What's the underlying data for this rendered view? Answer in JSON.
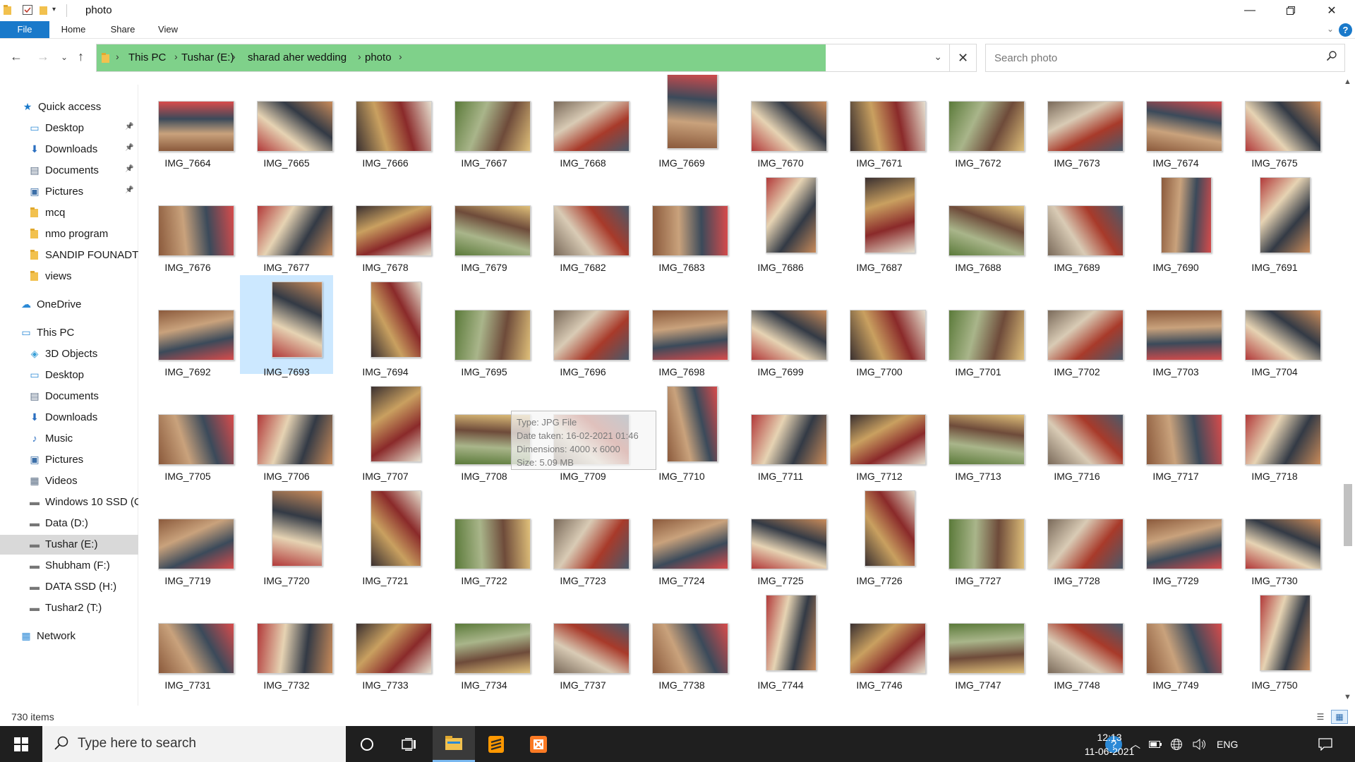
{
  "window": {
    "title": "photo",
    "tabs": [
      "File",
      "Home",
      "Share",
      "View"
    ],
    "help": "?"
  },
  "breadcrumb": [
    "This PC",
    "Tushar (E:)",
    "sharad aher wedding",
    "photo"
  ],
  "search": {
    "placeholder": "Search photo"
  },
  "nav": {
    "quick_access": "Quick access",
    "items": [
      {
        "label": "Quick access",
        "icon": "star-icon"
      },
      {
        "label": "Desktop",
        "icon": "desktop-icon",
        "pinned": true
      },
      {
        "label": "Downloads",
        "icon": "download-icon",
        "pinned": true
      },
      {
        "label": "Documents",
        "icon": "documents-icon",
        "pinned": true
      },
      {
        "label": "Pictures",
        "icon": "pictures-icon",
        "pinned": true
      },
      {
        "label": "mcq",
        "icon": "folder-icon"
      },
      {
        "label": "nmo program",
        "icon": "folder-icon"
      },
      {
        "label": "SANDIP FOUNADTI(",
        "icon": "folder-icon"
      },
      {
        "label": "views",
        "icon": "folder-icon"
      },
      {
        "label": "OneDrive",
        "icon": "cloud-icon"
      },
      {
        "label": "This PC",
        "icon": "computer-icon"
      },
      {
        "label": "3D Objects",
        "icon": "cube-icon"
      },
      {
        "label": "Desktop",
        "icon": "desktop-icon"
      },
      {
        "label": "Documents",
        "icon": "documents-icon"
      },
      {
        "label": "Downloads",
        "icon": "download-icon"
      },
      {
        "label": "Music",
        "icon": "music-icon"
      },
      {
        "label": "Pictures",
        "icon": "pictures-icon"
      },
      {
        "label": "Videos",
        "icon": "video-icon"
      },
      {
        "label": "Windows 10 SSD (C",
        "icon": "drive-icon"
      },
      {
        "label": "Data (D:)",
        "icon": "drive-icon"
      },
      {
        "label": "Tushar (E:)",
        "icon": "drive-icon"
      },
      {
        "label": "Shubham (F:)",
        "icon": "drive-icon"
      },
      {
        "label": "DATA SSD (H:)",
        "icon": "drive-icon"
      },
      {
        "label": "Tushar2 (T:)",
        "icon": "drive-icon"
      },
      {
        "label": "Network",
        "icon": "network-icon"
      }
    ]
  },
  "files": [
    {
      "name": "IMG_7664",
      "orient": "l"
    },
    {
      "name": "IMG_7665",
      "orient": "l"
    },
    {
      "name": "IMG_7666",
      "orient": "l"
    },
    {
      "name": "IMG_7667",
      "orient": "l"
    },
    {
      "name": "IMG_7668",
      "orient": "l"
    },
    {
      "name": "IMG_7669",
      "orient": "p"
    },
    {
      "name": "IMG_7670",
      "orient": "l"
    },
    {
      "name": "IMG_7671",
      "orient": "l"
    },
    {
      "name": "IMG_7672",
      "orient": "l"
    },
    {
      "name": "IMG_7673",
      "orient": "l"
    },
    {
      "name": "IMG_7674",
      "orient": "l"
    },
    {
      "name": "IMG_7675",
      "orient": "l"
    },
    {
      "name": "IMG_7676",
      "orient": "l"
    },
    {
      "name": "IMG_7677",
      "orient": "l"
    },
    {
      "name": "IMG_7678",
      "orient": "l"
    },
    {
      "name": "IMG_7679",
      "orient": "l"
    },
    {
      "name": "IMG_7682",
      "orient": "l"
    },
    {
      "name": "IMG_7683",
      "orient": "l"
    },
    {
      "name": "IMG_7686",
      "orient": "p"
    },
    {
      "name": "IMG_7687",
      "orient": "p"
    },
    {
      "name": "IMG_7688",
      "orient": "l"
    },
    {
      "name": "IMG_7689",
      "orient": "l"
    },
    {
      "name": "IMG_7690",
      "orient": "p"
    },
    {
      "name": "IMG_7691",
      "orient": "p"
    },
    {
      "name": "IMG_7692",
      "orient": "l"
    },
    {
      "name": "IMG_7693",
      "orient": "p",
      "selected": true
    },
    {
      "name": "IMG_7694",
      "orient": "p"
    },
    {
      "name": "IMG_7695",
      "orient": "l"
    },
    {
      "name": "IMG_7696",
      "orient": "l"
    },
    {
      "name": "IMG_7698",
      "orient": "l"
    },
    {
      "name": "IMG_7699",
      "orient": "l"
    },
    {
      "name": "IMG_7700",
      "orient": "l"
    },
    {
      "name": "IMG_7701",
      "orient": "l"
    },
    {
      "name": "IMG_7702",
      "orient": "l"
    },
    {
      "name": "IMG_7703",
      "orient": "l"
    },
    {
      "name": "IMG_7704",
      "orient": "l"
    },
    {
      "name": "IMG_7705",
      "orient": "l"
    },
    {
      "name": "IMG_7706",
      "orient": "l"
    },
    {
      "name": "IMG_7707",
      "orient": "p"
    },
    {
      "name": "IMG_7708",
      "orient": "l"
    },
    {
      "name": "IMG_7709",
      "orient": "l"
    },
    {
      "name": "IMG_7710",
      "orient": "p"
    },
    {
      "name": "IMG_7711",
      "orient": "l"
    },
    {
      "name": "IMG_7712",
      "orient": "l"
    },
    {
      "name": "IMG_7713",
      "orient": "l"
    },
    {
      "name": "IMG_7716",
      "orient": "l"
    },
    {
      "name": "IMG_7717",
      "orient": "l"
    },
    {
      "name": "IMG_7718",
      "orient": "l"
    },
    {
      "name": "IMG_7719",
      "orient": "l"
    },
    {
      "name": "IMG_7720",
      "orient": "p"
    },
    {
      "name": "IMG_7721",
      "orient": "p"
    },
    {
      "name": "IMG_7722",
      "orient": "l"
    },
    {
      "name": "IMG_7723",
      "orient": "l"
    },
    {
      "name": "IMG_7724",
      "orient": "l"
    },
    {
      "name": "IMG_7725",
      "orient": "l"
    },
    {
      "name": "IMG_7726",
      "orient": "p"
    },
    {
      "name": "IMG_7727",
      "orient": "l"
    },
    {
      "name": "IMG_7728",
      "orient": "l"
    },
    {
      "name": "IMG_7729",
      "orient": "l"
    },
    {
      "name": "IMG_7730",
      "orient": "l"
    },
    {
      "name": "IMG_7731",
      "orient": "l"
    },
    {
      "name": "IMG_7732",
      "orient": "l"
    },
    {
      "name": "IMG_7733",
      "orient": "l"
    },
    {
      "name": "IMG_7734",
      "orient": "l"
    },
    {
      "name": "IMG_7737",
      "orient": "l"
    },
    {
      "name": "IMG_7738",
      "orient": "l"
    },
    {
      "name": "IMG_7744",
      "orient": "p"
    },
    {
      "name": "IMG_7746",
      "orient": "l"
    },
    {
      "name": "IMG_7747",
      "orient": "l"
    },
    {
      "name": "IMG_7748",
      "orient": "l"
    },
    {
      "name": "IMG_7749",
      "orient": "l"
    },
    {
      "name": "IMG_7750",
      "orient": "p"
    }
  ],
  "tooltip": {
    "lines": [
      "Type: JPG File",
      "Date taken: 16-02-2021 01:46",
      "Dimensions: 4000 x 6000",
      "Size: 5.09 MB"
    ]
  },
  "status": {
    "item_count": "730 items"
  },
  "taskbar": {
    "search_text": "Type here to search",
    "language": "ENG",
    "time": "12:13",
    "date": "11-06-2021"
  },
  "colors": {
    "accent": "#1979ca",
    "address_highlight": "#7fd18a",
    "selection": "#cce8ff",
    "taskbar": "#1f1f1f"
  }
}
